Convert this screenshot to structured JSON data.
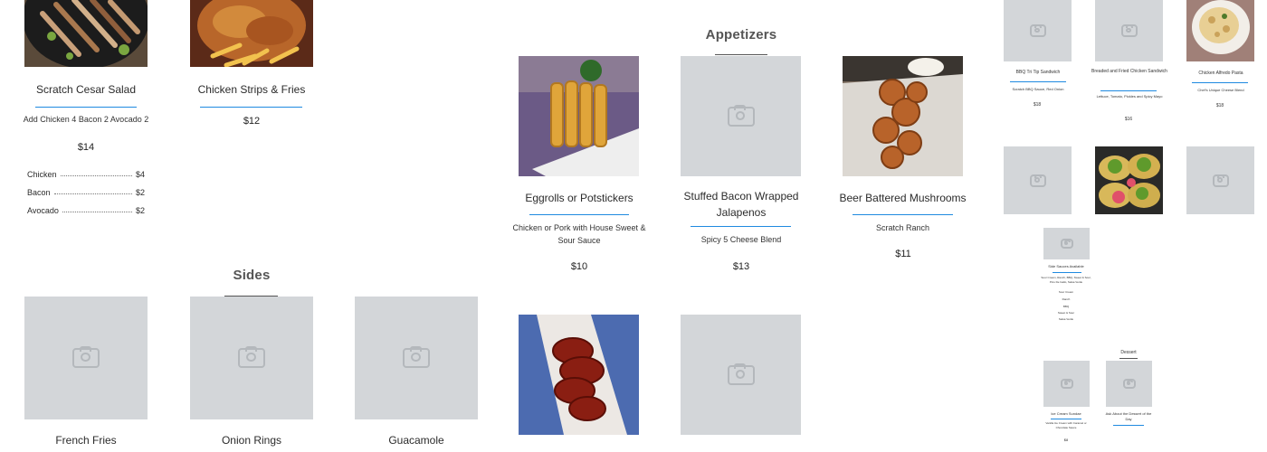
{
  "colors": {
    "accent": "#1f8ae0",
    "placeholder": "#d3d6d9",
    "section_title": "#555555"
  },
  "salads": {
    "scratch_cesar": {
      "name": "Scratch Cesar Salad",
      "desc": "Add Chicken 4 Bacon 2 Avocado 2",
      "price": "$14",
      "options": [
        {
          "label": "Chicken",
          "price": "$4"
        },
        {
          "label": "Bacon",
          "price": "$2"
        },
        {
          "label": "Avocado",
          "price": "$2"
        }
      ]
    },
    "chicken_strips": {
      "name": "Chicken Strips & Fries",
      "price": "$12"
    }
  },
  "sides": {
    "title": "Sides",
    "items": [
      {
        "name": "French Fries"
      },
      {
        "name": "Onion Rings"
      },
      {
        "name": "Guacamole"
      }
    ]
  },
  "appetizers": {
    "title": "Appetizers",
    "items": [
      {
        "name": "Eggrolls or Potstickers",
        "desc": "Chicken or Pork with House Sweet & Sour Sauce",
        "price": "$10"
      },
      {
        "name": "Stuffed Bacon Wrapped Jalapenos",
        "desc": "Spicy 5 Cheese Blend",
        "price": "$13"
      },
      {
        "name": "Beer Battered Mushrooms",
        "desc": "Scratch Ranch",
        "price": "$11"
      }
    ]
  },
  "mini_menu": {
    "items": [
      {
        "name": "BBQ Tri Tip Sandwich",
        "desc": "Scratch BBQ Sauce, Red Onion",
        "price": "$18"
      },
      {
        "name": "Breaded and Fried Chicken Sandwich",
        "desc": "Lettuce, Tomato, Pickles and Spicy Mayo",
        "price": "$16"
      },
      {
        "name": "Chicken Alfredo Pasta",
        "desc": "Chef's Unique Cheese Blend",
        "price": "$18"
      }
    ],
    "sauces": {
      "title": "Side Sauces Available",
      "desc": "Sour Cream, Ranch, BBQ, Sweet & Sour, Pico De Gallo, Salsa Verde",
      "list": [
        "Sour Cream",
        "Ranch",
        "BBQ",
        "Sweet & Sour",
        "Salsa Verde"
      ]
    },
    "dessert": {
      "title": "Dessert",
      "items": [
        {
          "name": "Ice Cream Sundae",
          "desc": "Vanilla Ice Cream with Caramel or Chocolate Sauce",
          "price": "$8"
        },
        {
          "name": "Ask About the Dessert of the Day"
        }
      ]
    }
  }
}
